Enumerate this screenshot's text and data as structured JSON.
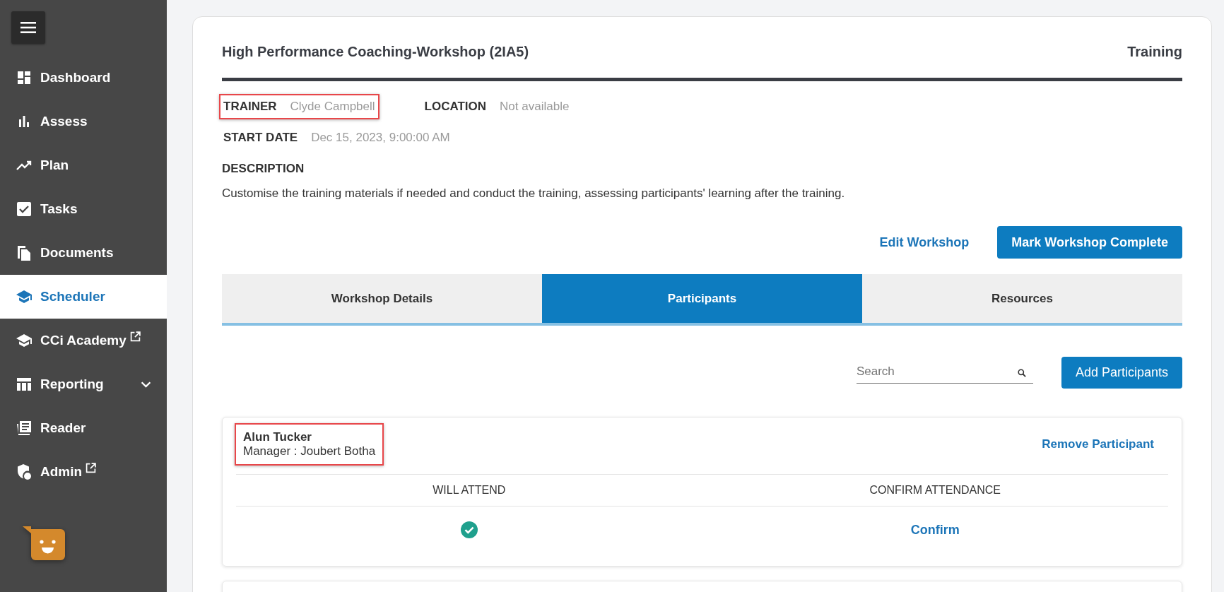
{
  "sidebar": {
    "items": [
      {
        "label": "Dashboard",
        "kind": "dashboard",
        "selected": false,
        "external": false,
        "expandable": false
      },
      {
        "label": "Assess",
        "kind": "bars",
        "selected": false,
        "external": false,
        "expandable": false
      },
      {
        "label": "Plan",
        "kind": "trend",
        "selected": false,
        "external": false,
        "expandable": false
      },
      {
        "label": "Tasks",
        "kind": "check",
        "selected": false,
        "external": false,
        "expandable": false
      },
      {
        "label": "Documents",
        "kind": "docs",
        "selected": false,
        "external": false,
        "expandable": false
      },
      {
        "label": "Scheduler",
        "kind": "cap",
        "selected": true,
        "external": false,
        "expandable": false
      },
      {
        "label": "CCi Academy",
        "kind": "cap",
        "selected": false,
        "external": true,
        "expandable": false
      },
      {
        "label": "Reporting",
        "kind": "table",
        "selected": false,
        "external": false,
        "expandable": true
      },
      {
        "label": "Reader",
        "kind": "reader",
        "selected": false,
        "external": false,
        "expandable": false
      },
      {
        "label": "Admin",
        "kind": "shield",
        "selected": false,
        "external": true,
        "expandable": false
      }
    ]
  },
  "header": {
    "title": "High Performance Coaching-Workshop (2IA5)",
    "category": "Training"
  },
  "details": [
    [
      {
        "label": "TRAINER",
        "value": "Clyde Campbell",
        "highlighted": true
      },
      {
        "label": "LOCATION",
        "value": "Not available",
        "highlighted": false
      }
    ],
    [
      {
        "label": "START DATE",
        "value": "Dec 15, 2023, 9:00:00 AM",
        "highlighted": false
      }
    ]
  ],
  "description": {
    "label": "DESCRIPTION",
    "text": "Customise the training materials if needed and conduct the training, assessing participants' learning after the training."
  },
  "actions": {
    "edit": "Edit Workshop",
    "complete": "Mark Workshop Complete"
  },
  "tabs": [
    {
      "label": "Workshop Details",
      "selected": false
    },
    {
      "label": "Participants",
      "selected": true
    },
    {
      "label": "Resources",
      "selected": false
    }
  ],
  "search": {
    "placeholder": "Search"
  },
  "add_button": "Add Participants",
  "participants": [
    {
      "name": "Alun Tucker",
      "manager": "Manager : Joubert Botha",
      "highlighted": true,
      "remove": "Remove Participant",
      "columns": [
        "WILL ATTEND",
        "CONFIRM ATTENDANCE"
      ],
      "will_attend": true,
      "confirm": "Confirm"
    }
  ]
}
